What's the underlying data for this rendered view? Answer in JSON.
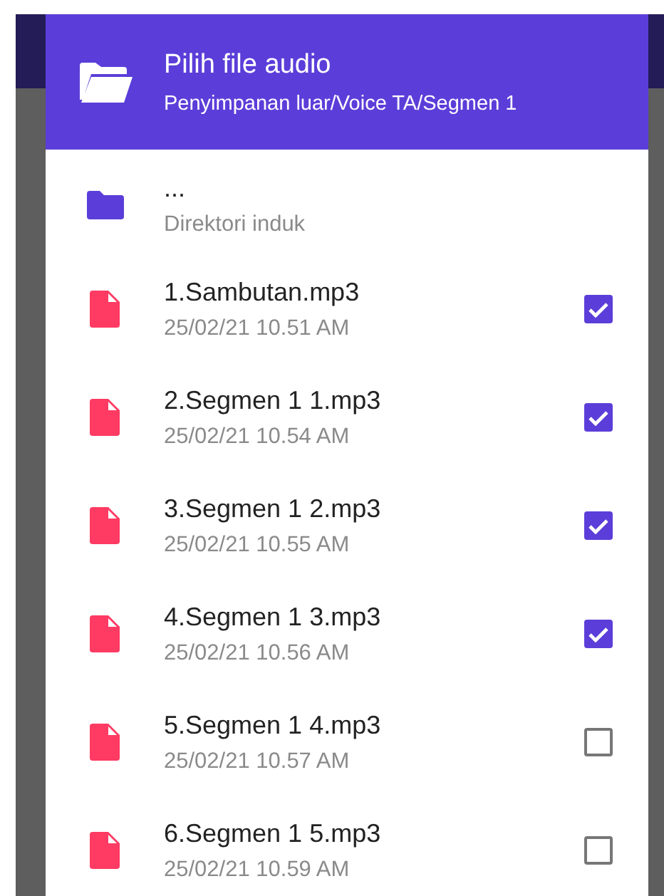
{
  "dialog": {
    "title": "Pilih file audio",
    "path": "Penyimpanan luar/Voice TA/Segmen 1"
  },
  "parent": {
    "name": "...",
    "label": "Direktori induk"
  },
  "files": [
    {
      "name": "1.Sambutan.mp3",
      "date": "25/02/21 10.51 AM",
      "checked": true
    },
    {
      "name": "2.Segmen 1 1.mp3",
      "date": "25/02/21 10.54 AM",
      "checked": true
    },
    {
      "name": "3.Segmen 1 2.mp3",
      "date": "25/02/21 10.55 AM",
      "checked": true
    },
    {
      "name": "4.Segmen 1 3.mp3",
      "date": "25/02/21 10.56 AM",
      "checked": true
    },
    {
      "name": "5.Segmen 1 4.mp3",
      "date": "25/02/21 10.57 AM",
      "checked": false
    },
    {
      "name": "6.Segmen 1 5.mp3",
      "date": "25/02/21 10.59 AM",
      "checked": false
    }
  ]
}
